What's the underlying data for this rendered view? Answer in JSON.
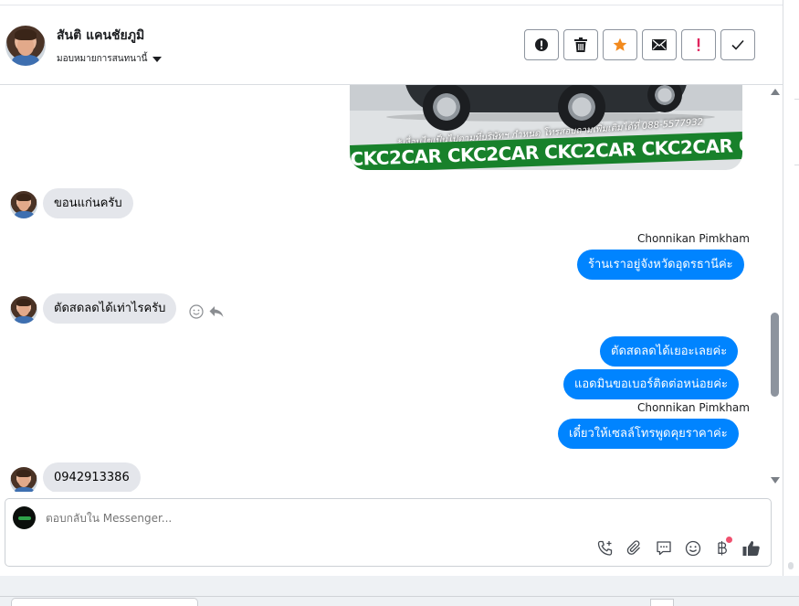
{
  "header": {
    "contact_name": "สันติ แคนชัยภูมิ",
    "assign_label": "มอบหมายการสนทนานี้",
    "actions": [
      {
        "name": "report-spam-button",
        "icon": "alert-circle-icon",
        "glyph": "⬤"
      },
      {
        "name": "delete-button",
        "icon": "trash-icon",
        "glyph": "🗑"
      },
      {
        "name": "star-button",
        "icon": "star-icon",
        "glyph": "★"
      },
      {
        "name": "mark-unread-button",
        "icon": "envelope-icon",
        "glyph": "✉"
      },
      {
        "name": "follow-up-button",
        "icon": "exclamation-icon",
        "glyph": "!"
      },
      {
        "name": "mark-done-button",
        "icon": "check-icon",
        "glyph": "✓"
      }
    ]
  },
  "attachment": {
    "caption": "*เงื่อนไขเป็นไปตามที่บริษัทฯ กำหนด โทรสอบถามเพิ่มเติมได้ที่ 088-5577932",
    "banner": "CKC2CAR CKC2CAR CKC2CAR CKC2CAR CKC2CAR CKC2"
  },
  "messages": {
    "m1": "ขอนแก่นครับ",
    "sender1": "Chonnikan Pimkham",
    "m2": "ร้านเราอยู่จังหวัดอุดรธานีค่ะ",
    "m3": "ตัดสดลดได้เท่าไรครับ",
    "m4": "ตัดสดลดได้เยอะเลยค่ะ",
    "m5": "แอดมินขอเบอร์ติดต่อหน่อยค่ะ",
    "sender2": "Chonnikan Pimkham",
    "m6": "เดี๋ยวให้เซลล์โทรพูดคุยราคาค่ะ",
    "m7": "0942913386"
  },
  "composer": {
    "placeholder": "ตอบกลับใน Messenger..."
  },
  "colors": {
    "outgoing": "#0084ff",
    "incoming": "#e4e6eb",
    "star": "#f28a1e",
    "follow_up": "#e0245e"
  }
}
